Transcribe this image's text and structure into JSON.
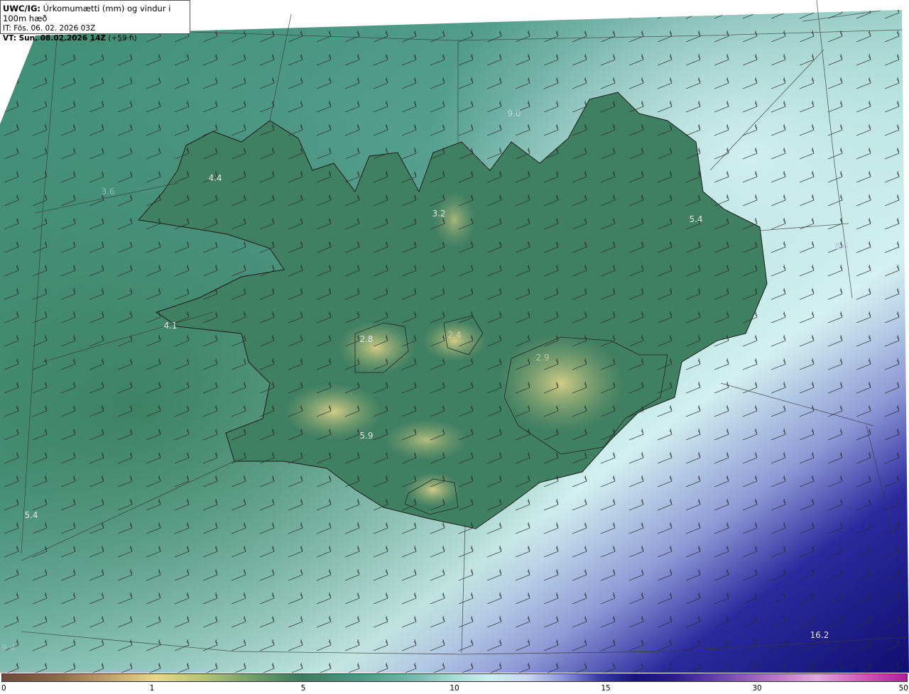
{
  "header": {
    "line1_bold": "UWC/IG:",
    "line1_rest": " Úrkomumætti (mm) og vindur i 100m hæð",
    "line2": "IT: Fös. 06. 02. 2026 03Z",
    "line3_bold": "VT: Sun. 08.02.2026 14Z",
    "line3_rest": " (+59 h)"
  },
  "value_labels": [
    {
      "text": "4.4"
    },
    {
      "text": "3.6"
    },
    {
      "text": "3.2"
    },
    {
      "text": "9.0"
    },
    {
      "text": "5.4"
    },
    {
      "text": "8.6"
    },
    {
      "text": "4.1"
    },
    {
      "text": "2.8"
    },
    {
      "text": "2.4"
    },
    {
      "text": "2.9"
    },
    {
      "text": "5.9"
    },
    {
      "text": "5.4"
    },
    {
      "text": "9.4"
    },
    {
      "text": "16.2"
    }
  ],
  "colorbar": {
    "ticks": [
      "0",
      "1",
      "5",
      "10",
      "15",
      "30",
      "50"
    ]
  },
  "colors": {
    "ocean_teal": "#4e9a86",
    "land_green": "#3d7a5e",
    "highland_yellow": "#cfcc86",
    "northeast_pale": "#cdeff0",
    "southeast_navy": "#14147a"
  }
}
